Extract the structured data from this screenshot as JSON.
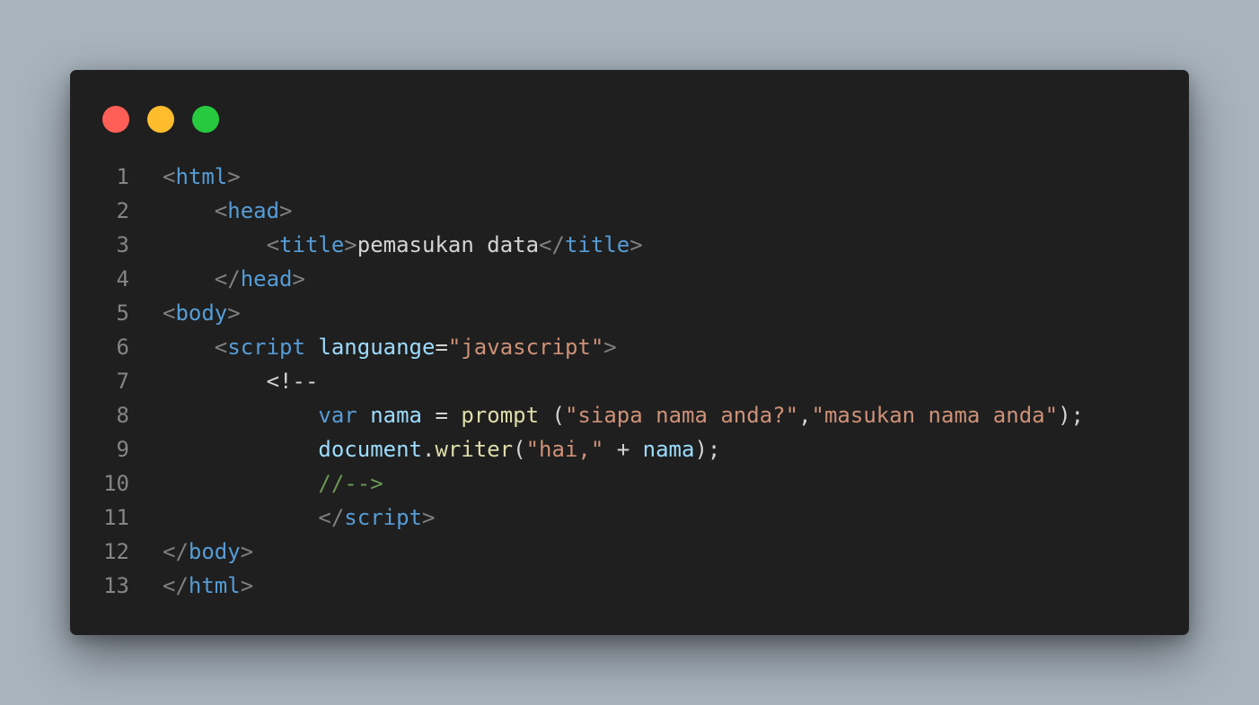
{
  "colors": {
    "page_background": "#a8b3bd",
    "window_background": "#1f1f1f",
    "line_number": "#858585",
    "punctuation": "#808080",
    "tag": "#569cd6",
    "text": "#d4d4d4",
    "attribute": "#9cdcfe",
    "string": "#ce9178",
    "function": "#dcdcaa",
    "comment": "#6a9955",
    "traffic_red": "#ff5f56",
    "traffic_yellow": "#ffbd2e",
    "traffic_green": "#27c93f"
  },
  "window_controls": [
    {
      "name": "close",
      "color": "#ff5f56"
    },
    {
      "name": "minimize",
      "color": "#ffbd2e"
    },
    {
      "name": "zoom",
      "color": "#27c93f"
    }
  ],
  "code_lines": [
    {
      "number": "1",
      "tokens": [
        {
          "text": "<",
          "type": "punctuation"
        },
        {
          "text": "html",
          "type": "tag"
        },
        {
          "text": ">",
          "type": "punctuation"
        }
      ]
    },
    {
      "number": "2",
      "tokens": [
        {
          "text": "    ",
          "type": "text"
        },
        {
          "text": "<",
          "type": "punctuation"
        },
        {
          "text": "head",
          "type": "tag"
        },
        {
          "text": ">",
          "type": "punctuation"
        }
      ]
    },
    {
      "number": "3",
      "tokens": [
        {
          "text": "        ",
          "type": "text"
        },
        {
          "text": "<",
          "type": "punctuation"
        },
        {
          "text": "title",
          "type": "tag"
        },
        {
          "text": ">",
          "type": "punctuation"
        },
        {
          "text": "pemasukan data",
          "type": "text"
        },
        {
          "text": "</",
          "type": "punctuation"
        },
        {
          "text": "title",
          "type": "tag"
        },
        {
          "text": ">",
          "type": "punctuation"
        }
      ]
    },
    {
      "number": "4",
      "tokens": [
        {
          "text": "    ",
          "type": "text"
        },
        {
          "text": "</",
          "type": "punctuation"
        },
        {
          "text": "head",
          "type": "tag"
        },
        {
          "text": ">",
          "type": "punctuation"
        }
      ]
    },
    {
      "number": "5",
      "tokens": [
        {
          "text": "<",
          "type": "punctuation"
        },
        {
          "text": "body",
          "type": "tag"
        },
        {
          "text": ">",
          "type": "punctuation"
        }
      ]
    },
    {
      "number": "6",
      "tokens": [
        {
          "text": "    ",
          "type": "text"
        },
        {
          "text": "<",
          "type": "punctuation"
        },
        {
          "text": "script",
          "type": "tag"
        },
        {
          "text": " ",
          "type": "text"
        },
        {
          "text": "languange",
          "type": "attribute"
        },
        {
          "text": "=",
          "type": "text"
        },
        {
          "text": "\"javascript\"",
          "type": "string"
        },
        {
          "text": ">",
          "type": "punctuation"
        }
      ]
    },
    {
      "number": "7",
      "tokens": [
        {
          "text": "        ",
          "type": "text"
        },
        {
          "text": "<!--",
          "type": "text"
        }
      ]
    },
    {
      "number": "8",
      "tokens": [
        {
          "text": "            ",
          "type": "text"
        },
        {
          "text": "var",
          "type": "tag"
        },
        {
          "text": " ",
          "type": "text"
        },
        {
          "text": "nama",
          "type": "attribute"
        },
        {
          "text": " = ",
          "type": "text"
        },
        {
          "text": "prompt",
          "type": "function"
        },
        {
          "text": " (",
          "type": "text"
        },
        {
          "text": "\"siapa nama anda?\"",
          "type": "string"
        },
        {
          "text": ",",
          "type": "text"
        },
        {
          "text": "\"masukan nama anda\"",
          "type": "string"
        },
        {
          "text": ");",
          "type": "text"
        }
      ]
    },
    {
      "number": "9",
      "tokens": [
        {
          "text": "            ",
          "type": "text"
        },
        {
          "text": "document",
          "type": "attribute"
        },
        {
          "text": ".",
          "type": "text"
        },
        {
          "text": "writer",
          "type": "function"
        },
        {
          "text": "(",
          "type": "text"
        },
        {
          "text": "\"hai,\"",
          "type": "string"
        },
        {
          "text": " + ",
          "type": "text"
        },
        {
          "text": "nama",
          "type": "attribute"
        },
        {
          "text": ");",
          "type": "text"
        }
      ]
    },
    {
      "number": "10",
      "tokens": [
        {
          "text": "            ",
          "type": "text"
        },
        {
          "text": "//-->",
          "type": "comment"
        }
      ]
    },
    {
      "number": "11",
      "tokens": [
        {
          "text": "            ",
          "type": "text"
        },
        {
          "text": "</",
          "type": "punctuation"
        },
        {
          "text": "script",
          "type": "tag"
        },
        {
          "text": ">",
          "type": "punctuation"
        }
      ]
    },
    {
      "number": "12",
      "tokens": [
        {
          "text": "</",
          "type": "punctuation"
        },
        {
          "text": "body",
          "type": "tag"
        },
        {
          "text": ">",
          "type": "punctuation"
        }
      ]
    },
    {
      "number": "13",
      "tokens": [
        {
          "text": "</",
          "type": "punctuation"
        },
        {
          "text": "html",
          "type": "tag"
        },
        {
          "text": ">",
          "type": "punctuation"
        }
      ]
    }
  ]
}
